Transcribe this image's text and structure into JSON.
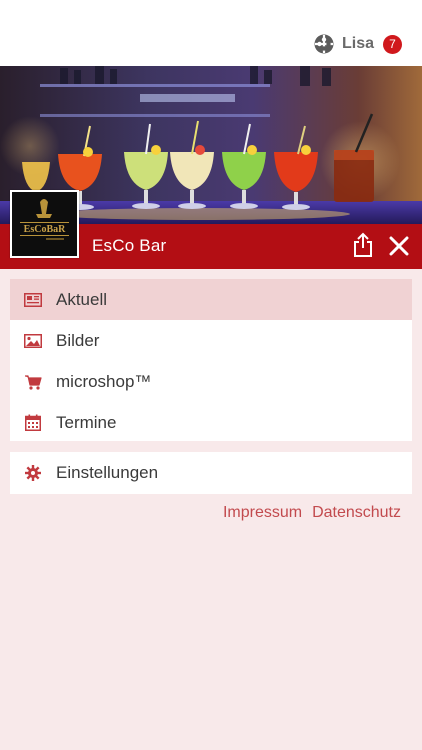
{
  "header": {
    "user_name": "Lisa",
    "notification_count": "7",
    "user_logo_icon": "puzzle-logo-icon"
  },
  "hero": {
    "image": "cocktail-glasses-on-bar-counter"
  },
  "bar": {
    "title": "EsCo  Bar",
    "logo_text": "EsCoBaR",
    "share_icon": "share-icon",
    "close_icon": "close-icon",
    "background_color": "#b30e14"
  },
  "menu": {
    "items": [
      {
        "label": "Aktuell",
        "icon": "news-icon",
        "active": true
      },
      {
        "label": "Bilder",
        "icon": "image-icon",
        "active": false
      },
      {
        "label": "microshop™",
        "icon": "cart-icon",
        "active": false
      },
      {
        "label": "Termine",
        "icon": "calendar-icon",
        "active": false
      }
    ],
    "settings": {
      "label": "Einstellungen",
      "icon": "gear-icon"
    }
  },
  "footer": {
    "impressum": "Impressum",
    "datenschutz": "Datenschutz"
  },
  "colors": {
    "accent": "#b30e14",
    "icon": "#c13a3f",
    "page_background": "#f8e9ea",
    "active_item": "#f0d2d3",
    "badge": "#d0181c"
  }
}
